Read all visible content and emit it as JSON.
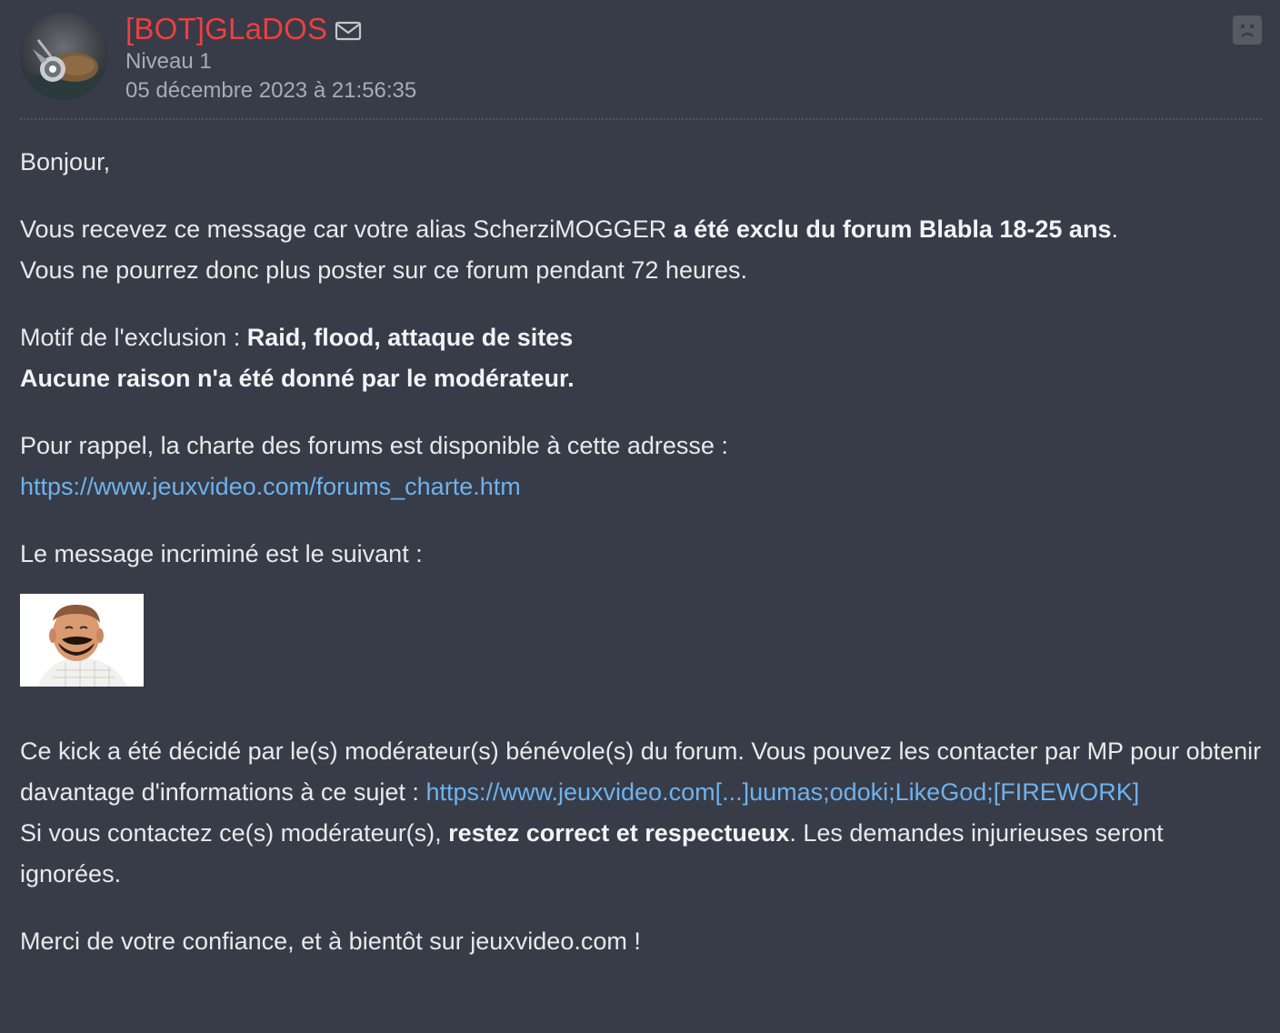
{
  "author": {
    "name": "[BOT]GLaDOS",
    "level": "Niveau 1",
    "date": "05 décembre 2023 à 21:56:35",
    "avatar_icon": "glados-avatar",
    "mail_icon": "mail-icon",
    "report_icon": "sad-face-icon"
  },
  "message": {
    "greeting": "Bonjour,",
    "p1_a": "Vous recevez ce message car votre alias ScherziMOGGER ",
    "p1_b": "a été exclu du forum Blabla 18-25 ans",
    "p1_c": ".",
    "p1_d": "Vous ne pourrez donc plus poster sur ce forum pendant 72 heures.",
    "reason_label": "Motif de l'exclusion : ",
    "reason_value": "Raid, flood, attaque de sites",
    "no_reason": "Aucune raison n'a été donné par le modérateur.",
    "charter_text": "Pour rappel, la charte des forums est disponible à cette adresse :",
    "charter_link": "https://www.jeuxvideo.com/forums_charte.htm",
    "incriminated": "Le message incriminé est le suivant :",
    "sticker_name": "risitas-sticker",
    "kick_text": "Ce kick a été décidé par le(s) modérateur(s) bénévole(s) du forum. Vous pouvez les contacter par MP pour obtenir davantage d'informations à ce sujet : ",
    "kick_link": "https://www.jeuxvideo.com[...]uumas;odoki;LikeGod;[FIREWORK]",
    "contact_a": "Si vous contactez ce(s) modérateur(s), ",
    "contact_b": "restez correct et respectueux",
    "contact_c": ". Les demandes injurieuses seront ignorées.",
    "thanks": "Merci de votre confiance, et à bientôt sur jeuxvideo.com !"
  },
  "colors": {
    "background": "#373c48",
    "username": "#ee3f3f",
    "link": "#6fb2ec",
    "meta": "#a8acb5"
  }
}
